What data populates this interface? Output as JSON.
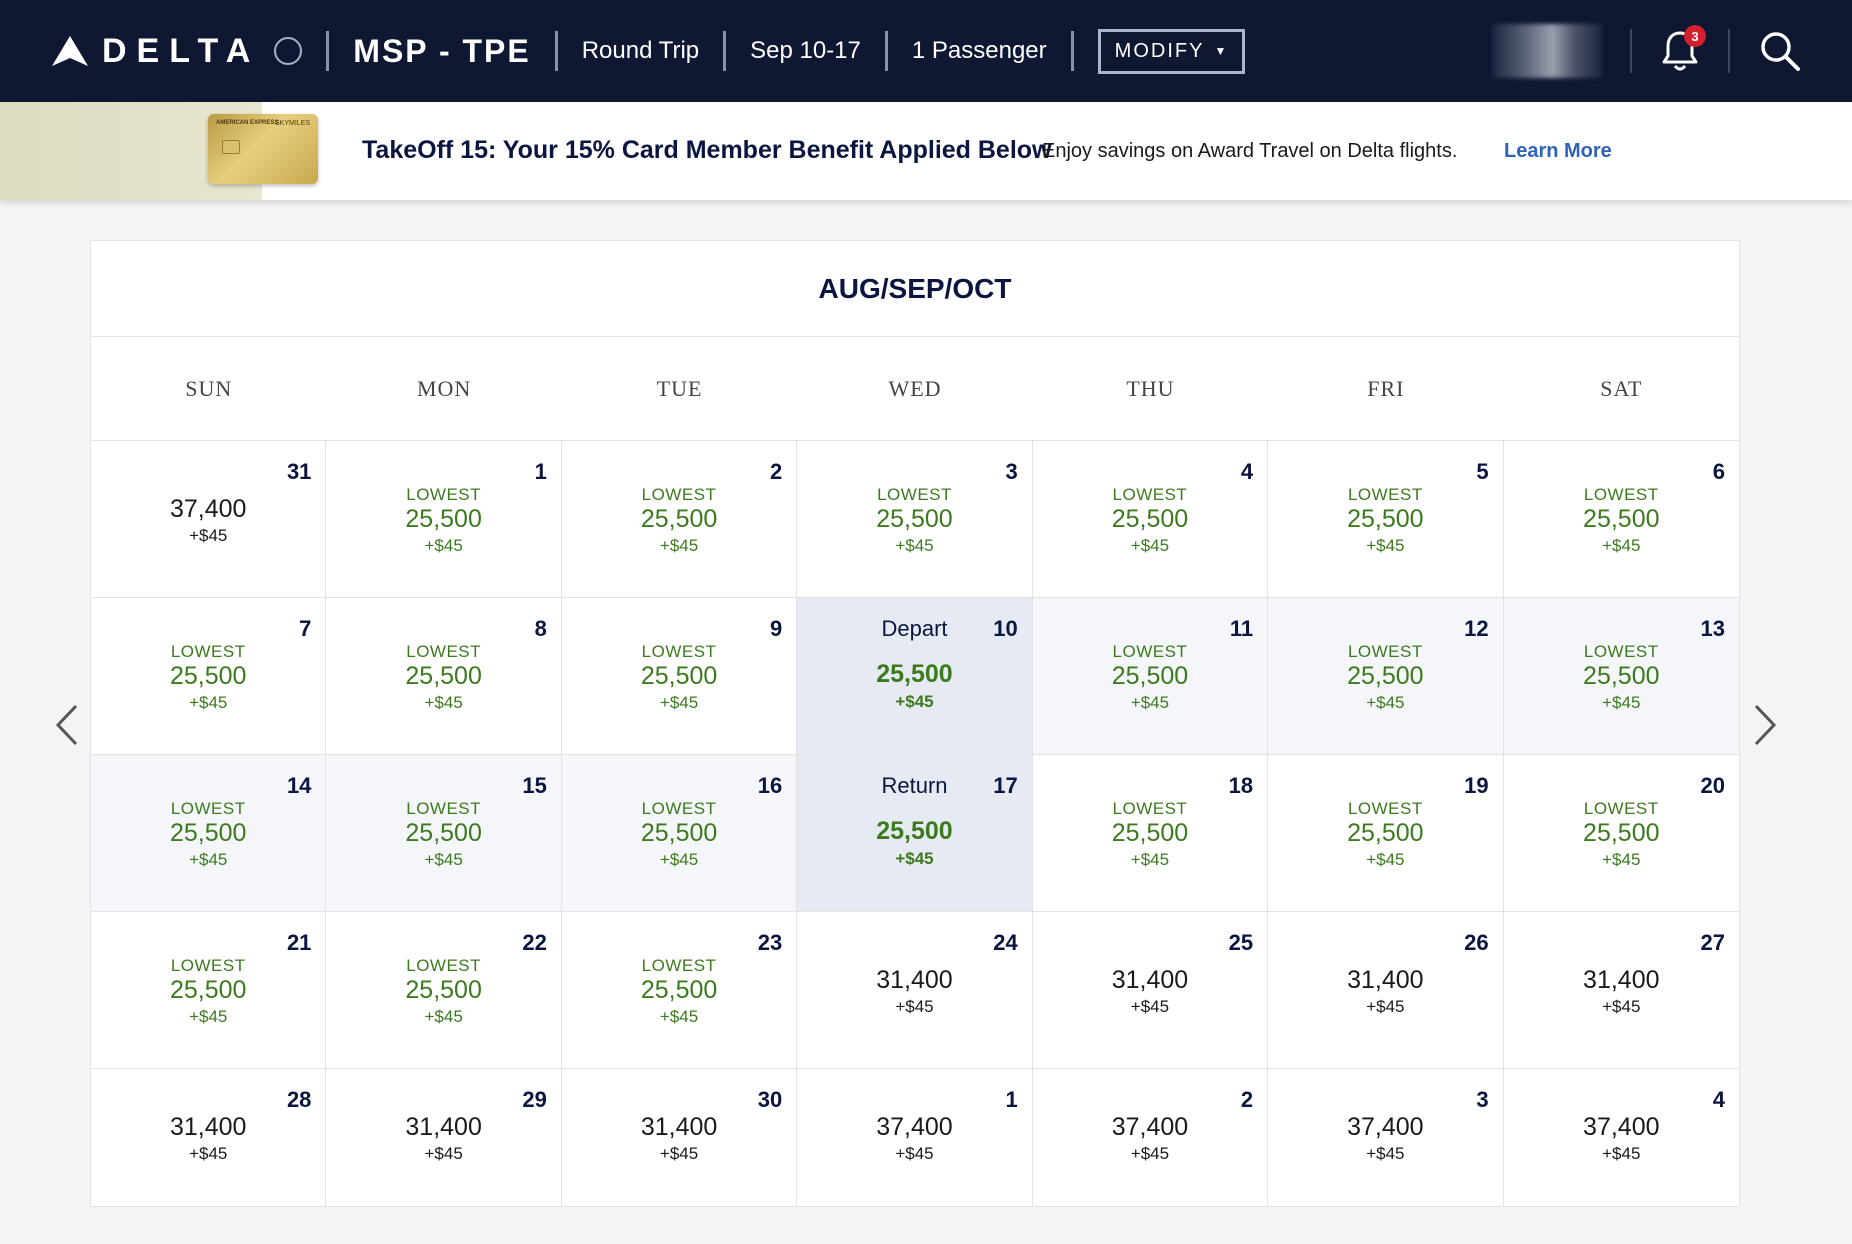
{
  "header": {
    "logo_text": "DELTA",
    "route": "MSP - TPE",
    "trip_type": "Round Trip",
    "dates": "Sep 10-17",
    "passengers": "1 Passenger",
    "modify_label": "MODIFY",
    "notification_count": "3",
    "icons": [
      "delta-logo-icon",
      "chevron-down-icon",
      "bell-icon",
      "search-icon"
    ]
  },
  "promo": {
    "title": "TakeOff 15: Your 15% Card Member Benefit Applied Below",
    "text": "Enjoy savings on Award Travel on Delta flights.",
    "link": "Learn More",
    "card_line1": "AMERICAN EXPRESS",
    "card_line2": "SKYMILES"
  },
  "calendar": {
    "title": "AUG/SEP/OCT",
    "weekdays": [
      "SUN",
      "MON",
      "TUE",
      "WED",
      "THU",
      "FRI",
      "SAT"
    ],
    "lowest_label": "LOWEST",
    "days": [
      {
        "day": "31",
        "price": "37,400",
        "fee": "+$45",
        "type": "plain"
      },
      {
        "day": "1",
        "price": "25,500",
        "fee": "+$45",
        "type": "low"
      },
      {
        "day": "2",
        "price": "25,500",
        "fee": "+$45",
        "type": "low"
      },
      {
        "day": "3",
        "price": "25,500",
        "fee": "+$45",
        "type": "low"
      },
      {
        "day": "4",
        "price": "25,500",
        "fee": "+$45",
        "type": "low"
      },
      {
        "day": "5",
        "price": "25,500",
        "fee": "+$45",
        "type": "low"
      },
      {
        "day": "6",
        "price": "25,500",
        "fee": "+$45",
        "type": "low"
      },
      {
        "day": "7",
        "price": "25,500",
        "fee": "+$45",
        "type": "low"
      },
      {
        "day": "8",
        "price": "25,500",
        "fee": "+$45",
        "type": "low"
      },
      {
        "day": "9",
        "price": "25,500",
        "fee": "+$45",
        "type": "low"
      },
      {
        "day": "10",
        "price": "25,500",
        "fee": "+$45",
        "type": "sel",
        "label": "Depart"
      },
      {
        "day": "11",
        "price": "25,500",
        "fee": "+$45",
        "type": "low",
        "range": true
      },
      {
        "day": "12",
        "price": "25,500",
        "fee": "+$45",
        "type": "low",
        "range": true
      },
      {
        "day": "13",
        "price": "25,500",
        "fee": "+$45",
        "type": "low",
        "range": true
      },
      {
        "day": "14",
        "price": "25,500",
        "fee": "+$45",
        "type": "low",
        "range": true
      },
      {
        "day": "15",
        "price": "25,500",
        "fee": "+$45",
        "type": "low",
        "range": true
      },
      {
        "day": "16",
        "price": "25,500",
        "fee": "+$45",
        "type": "low",
        "range": true
      },
      {
        "day": "17",
        "price": "25,500",
        "fee": "+$45",
        "type": "sel",
        "label": "Return"
      },
      {
        "day": "18",
        "price": "25,500",
        "fee": "+$45",
        "type": "low"
      },
      {
        "day": "19",
        "price": "25,500",
        "fee": "+$45",
        "type": "low"
      },
      {
        "day": "20",
        "price": "25,500",
        "fee": "+$45",
        "type": "low"
      },
      {
        "day": "21",
        "price": "25,500",
        "fee": "+$45",
        "type": "low"
      },
      {
        "day": "22",
        "price": "25,500",
        "fee": "+$45",
        "type": "low"
      },
      {
        "day": "23",
        "price": "25,500",
        "fee": "+$45",
        "type": "low"
      },
      {
        "day": "24",
        "price": "31,400",
        "fee": "+$45",
        "type": "plain"
      },
      {
        "day": "25",
        "price": "31,400",
        "fee": "+$45",
        "type": "plain"
      },
      {
        "day": "26",
        "price": "31,400",
        "fee": "+$45",
        "type": "plain"
      },
      {
        "day": "27",
        "price": "31,400",
        "fee": "+$45",
        "type": "plain"
      },
      {
        "day": "28",
        "price": "31,400",
        "fee": "+$45",
        "type": "plain"
      },
      {
        "day": "29",
        "price": "31,400",
        "fee": "+$45",
        "type": "plain"
      },
      {
        "day": "30",
        "price": "31,400",
        "fee": "+$45",
        "type": "plain"
      },
      {
        "day": "1",
        "price": "37,400",
        "fee": "+$45",
        "type": "plain"
      },
      {
        "day": "2",
        "price": "37,400",
        "fee": "+$45",
        "type": "plain"
      },
      {
        "day": "3",
        "price": "37,400",
        "fee": "+$45",
        "type": "plain"
      },
      {
        "day": "4",
        "price": "37,400",
        "fee": "+$45",
        "type": "plain"
      }
    ]
  },
  "colors": {
    "header_bg": "#0f1733",
    "lowest_green": "#3c7a1e",
    "selected_bg": "#e6ebf3",
    "range_bg": "#f4f6fa",
    "link_blue": "#2f63b8",
    "badge_red": "#d3202f"
  }
}
